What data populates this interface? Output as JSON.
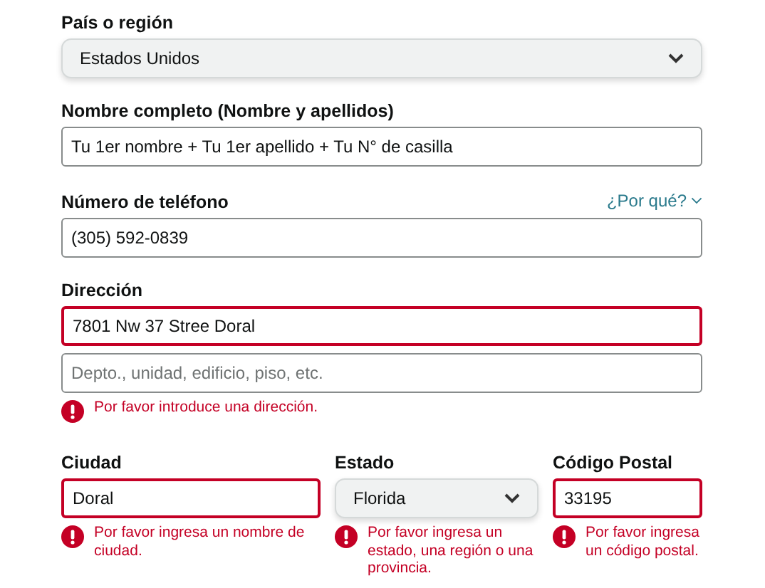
{
  "fields": [
    {
      "label": "País o región",
      "inputs": [
        {
          "kind": "select",
          "value": "Estados Unidos",
          "error": false
        }
      ]
    },
    {
      "label": "Nombre completo (Nombre y apellidos)",
      "inputs": [
        {
          "kind": "text",
          "value": "Tu 1er nombre + Tu 1er apellido + Tu N° de casilla",
          "error": false
        }
      ]
    },
    {
      "label": "Número de teléfono",
      "link": "¿Por qué?",
      "inputs": [
        {
          "kind": "text",
          "value": "(305) 592-0839",
          "error": false
        }
      ]
    },
    {
      "label": "Dirección",
      "inputs": [
        {
          "kind": "text",
          "value": "7801 Nw 37 Stree Doral",
          "error": true
        },
        {
          "kind": "text",
          "placeholder": "Depto., unidad, edificio, piso, etc.",
          "error": false
        }
      ],
      "message": "Por favor introduce una dirección."
    }
  ],
  "row": [
    {
      "label": "Ciudad",
      "inputs": [
        {
          "kind": "text",
          "value": "Doral",
          "error": true
        }
      ],
      "message": "Por favor ingresa un nombre de ciudad."
    },
    {
      "label": "Estado",
      "inputs": [
        {
          "kind": "select",
          "value": "Florida",
          "error": false
        }
      ],
      "message": "Por favor ingresa un estado, una región o una provincia."
    },
    {
      "label": "Código Postal",
      "inputs": [
        {
          "kind": "text",
          "value": "33195",
          "error": true
        }
      ],
      "message": "Por favor ingresa un código postal."
    }
  ]
}
